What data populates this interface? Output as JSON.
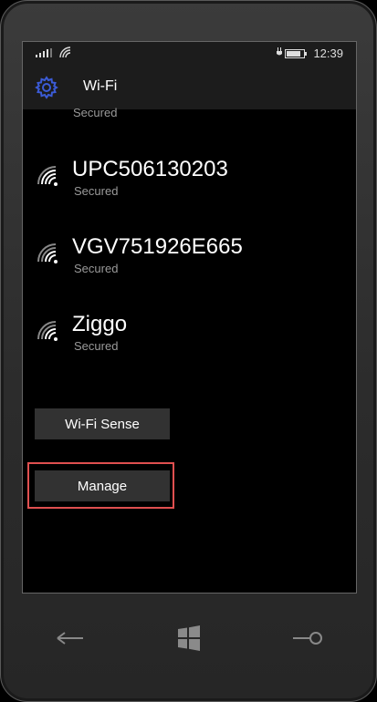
{
  "status": {
    "time": "12:39",
    "battery_level": 0.85
  },
  "header": {
    "title": "Wi-Fi",
    "icon": "gear-icon"
  },
  "networks_partial_top": {
    "status": "Secured"
  },
  "networks": [
    {
      "name": "UPC506130203",
      "status": "Secured"
    },
    {
      "name": "VGV751926E665",
      "status": "Secured"
    },
    {
      "name": "Ziggo",
      "status": "Secured"
    }
  ],
  "buttons": {
    "wifi_sense": "Wi-Fi Sense",
    "manage": "Manage"
  },
  "navigation": {
    "back": "back-arrow-icon",
    "start": "windows-logo-icon",
    "search": "search-icon"
  },
  "colors": {
    "accent": "#3b5bd6",
    "highlight": "#e05050",
    "button_bg": "#323232"
  }
}
